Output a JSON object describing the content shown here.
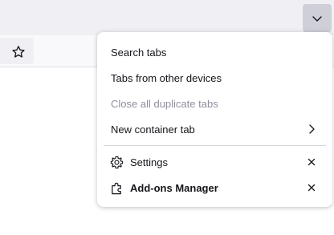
{
  "toolbar": {
    "star_icon": "star-icon",
    "list_all_tabs_icon": "chevron-down-icon"
  },
  "menu": {
    "items": [
      {
        "label": "Search tabs",
        "enabled": true
      },
      {
        "label": "Tabs from other devices",
        "enabled": true
      },
      {
        "label": "Close all duplicate tabs",
        "enabled": false
      },
      {
        "label": "New container tab",
        "enabled": true,
        "submenu": true
      }
    ],
    "extensions": [
      {
        "label": "Settings",
        "icon": "gear-icon",
        "close_icon": "close-icon"
      },
      {
        "label": "Add-ons Manager",
        "icon": "puzzle-piece-icon",
        "close_icon": "close-icon",
        "bold": true
      }
    ]
  },
  "colors": {
    "tabstrip_bg": "#f0f0f4",
    "button_active_bg": "#cfcfd8",
    "disabled_text": "#8f8f9d",
    "text": "#15141a"
  }
}
